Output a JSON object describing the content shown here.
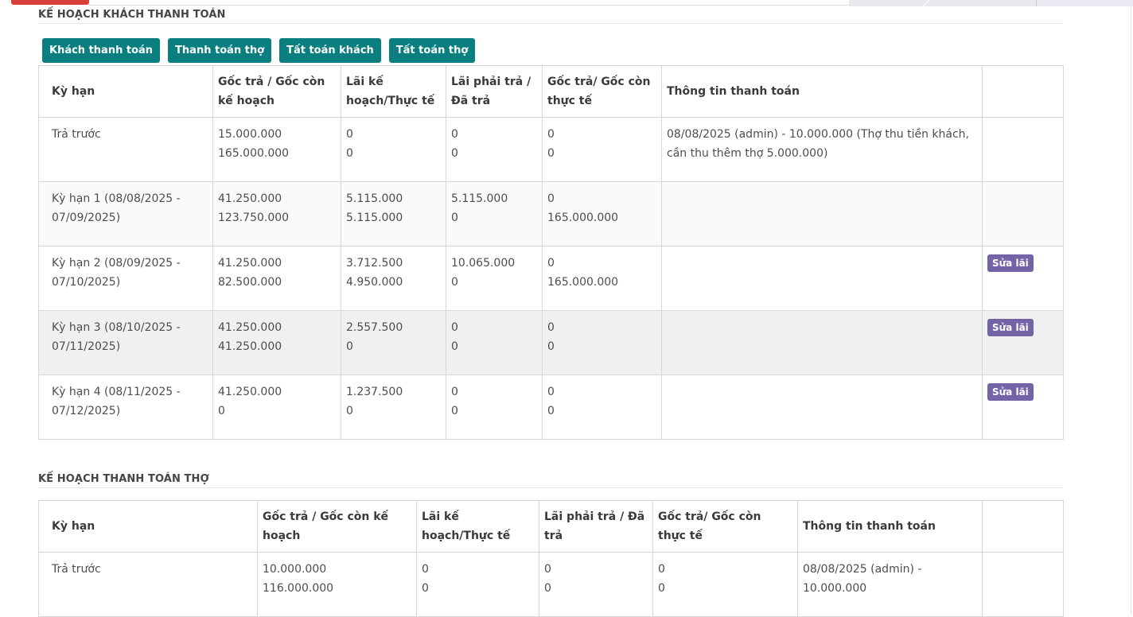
{
  "customer_plan": {
    "title": "KẾ HOẠCH KHÁCH THANH TOÁN",
    "buttons": [
      "Khách thanh toán",
      "Thanh toán thợ",
      "Tất toán khách",
      "Tất toán thợ"
    ],
    "headers": [
      "Kỳ hạn",
      "Gốc trả / Gốc còn kế hoạch",
      "Lãi kế hoạch/Thực tế",
      "Lãi phải trả / Đã trả",
      "Gốc trả/ Gốc còn thực tế",
      "Thông tin thanh toán",
      ""
    ],
    "rows": [
      {
        "term": "Trả trước",
        "principal_plan": [
          "15.000.000",
          "165.000.000"
        ],
        "interest_plan": [
          "0",
          "0"
        ],
        "interest_due": [
          "0",
          "0"
        ],
        "principal_actual": [
          "0",
          "0"
        ],
        "payment_info": "08/08/2025 (admin) - 10.000.000 (Thợ thu tiền khách, cần thu thêm thợ 5.000.000)",
        "action": ""
      },
      {
        "term": "Kỳ hạn 1 (08/08/2025 - 07/09/2025)",
        "principal_plan": [
          "41.250.000",
          "123.750.000"
        ],
        "interest_plan": [
          "5.115.000",
          "5.115.000"
        ],
        "interest_due": [
          "5.115.000",
          "0"
        ],
        "principal_actual": [
          "0",
          "165.000.000"
        ],
        "payment_info": "",
        "action": ""
      },
      {
        "term": "Kỳ hạn 2 (08/09/2025 - 07/10/2025)",
        "principal_plan": [
          "41.250.000",
          "82.500.000"
        ],
        "interest_plan": [
          "3.712.500",
          "4.950.000"
        ],
        "interest_due": [
          "10.065.000",
          "0"
        ],
        "principal_actual": [
          "0",
          "165.000.000"
        ],
        "payment_info": "",
        "action": "Sửa lãi"
      },
      {
        "term": "Kỳ hạn 3 (08/10/2025 - 07/11/2025)",
        "principal_plan": [
          "41.250.000",
          "41.250.000"
        ],
        "interest_plan": [
          "2.557.500",
          "0"
        ],
        "interest_due": [
          "0",
          "0"
        ],
        "principal_actual": [
          "0",
          "0"
        ],
        "payment_info": "",
        "action": "Sửa lãi"
      },
      {
        "term": "Kỳ hạn 4 (08/11/2025 - 07/12/2025)",
        "principal_plan": [
          "41.250.000",
          "0"
        ],
        "interest_plan": [
          "1.237.500",
          "0"
        ],
        "interest_due": [
          "0",
          "0"
        ],
        "principal_actual": [
          "0",
          "0"
        ],
        "payment_info": "",
        "action": "Sửa lãi"
      }
    ]
  },
  "worker_plan": {
    "title": "KẾ HOẠCH THANH TOÁN THỢ",
    "headers": [
      "Kỳ hạn",
      "Gốc trả / Gốc còn kế hoạch",
      "Lãi kế hoạch/Thực tế",
      "Lãi phải trả / Đã trả",
      "Gốc trả/ Gốc còn thực tế",
      "Thông tin thanh toán",
      ""
    ],
    "rows": [
      {
        "term": "Trả trước",
        "principal_plan": [
          "10.000.000",
          "116.000.000"
        ],
        "interest_plan": [
          "0",
          "0"
        ],
        "interest_due": [
          "0",
          "0"
        ],
        "principal_actual": [
          "0",
          "0"
        ],
        "payment_info": "08/08/2025 (admin) - 10.000.000",
        "action": ""
      }
    ]
  },
  "colors": {
    "button": "#0a7f7f",
    "badge": "#7563a8",
    "highlight_row": "#f0f0f0"
  }
}
